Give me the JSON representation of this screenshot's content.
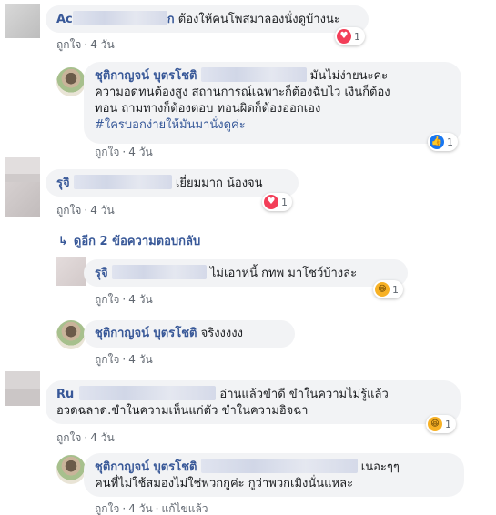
{
  "comments": [
    {
      "author_visible": "Ac",
      "author_suffix": "ก",
      "text": "ต้องให้คนโพสมาลองนั่งดูบ้างนะ",
      "like_label": "ถูกใจ",
      "time": "4 วัน",
      "reaction": {
        "icon": "love-icon",
        "count": "1"
      }
    },
    {
      "author": "ชุติกาญจน์ บุตรโชติ",
      "lines": [
        "มันไม่ง่ายนะคะ",
        "ความอดทนต้องสูง สถานการณ์เฉพาะก็ต้องฉับไว เงินก็ต้อง",
        "ทอน ถามทางก็ต้องตอบ ทอนผิดก็ต้องออกเอง"
      ],
      "hashtag": "#ใครบอกง่ายให้มันมานั่งดูค่ะ",
      "like_label": "ถูกใจ",
      "time": "4 วัน",
      "reaction": {
        "icon": "like-icon",
        "count": "1"
      }
    },
    {
      "author_visible": "รุจิ",
      "text": "เยี่ยมมาก น้องจน",
      "like_label": "ถูกใจ",
      "time": "4 วัน",
      "reaction": {
        "icon": "love-icon",
        "count": "1"
      }
    },
    {
      "more_replies_label": "ดูอีก 2 ข้อความตอบกลับ"
    },
    {
      "author_visible": "รุจิ",
      "text": "ไม่เอาหนี้ กทพ มาโชว์บ้างล่ะ",
      "like_label": "ถูกใจ",
      "time": "4 วัน",
      "reaction": {
        "icon": "haha-icon",
        "count": "1"
      }
    },
    {
      "author": "ชุติกาญจน์ บุตรโชติ",
      "text": "จริงงงงง",
      "like_label": "ถูกใจ",
      "time": "4 วัน"
    },
    {
      "author_visible": "Ru",
      "text_line1": "อ่านแล้วขำดี ขำในความไม่รู้แล้ว",
      "text_line2": "อวดฉลาด.ขำในความเห็นแก่ตัว ขำในความอิจฉา",
      "like_label": "ถูกใจ",
      "time": "4 วัน",
      "reaction": {
        "icon": "haha-icon",
        "count": "1"
      }
    },
    {
      "author": "ชุติกาญจน์ บุตรโชติ",
      "text_line1": "เนอะๆๆ",
      "text_line2": "คนที่ไม่ใช้สมองไม่ใช่พวกกูค่ะ กูว่าพวกเมิงนั่นแหละ",
      "like_label": "ถูกใจ",
      "time": "4 วัน",
      "edited_label": "แก้ไขแล้ว"
    }
  ],
  "colors": {
    "link": "#385898",
    "bubble": "#f2f3f5",
    "meta": "#606770",
    "love": "#f33e58",
    "like": "#1877f2",
    "haha": "#f7b125"
  },
  "glyphs": {
    "love": "♥",
    "like": "👍",
    "haha": "😆",
    "reply_arrow": "↳"
  }
}
